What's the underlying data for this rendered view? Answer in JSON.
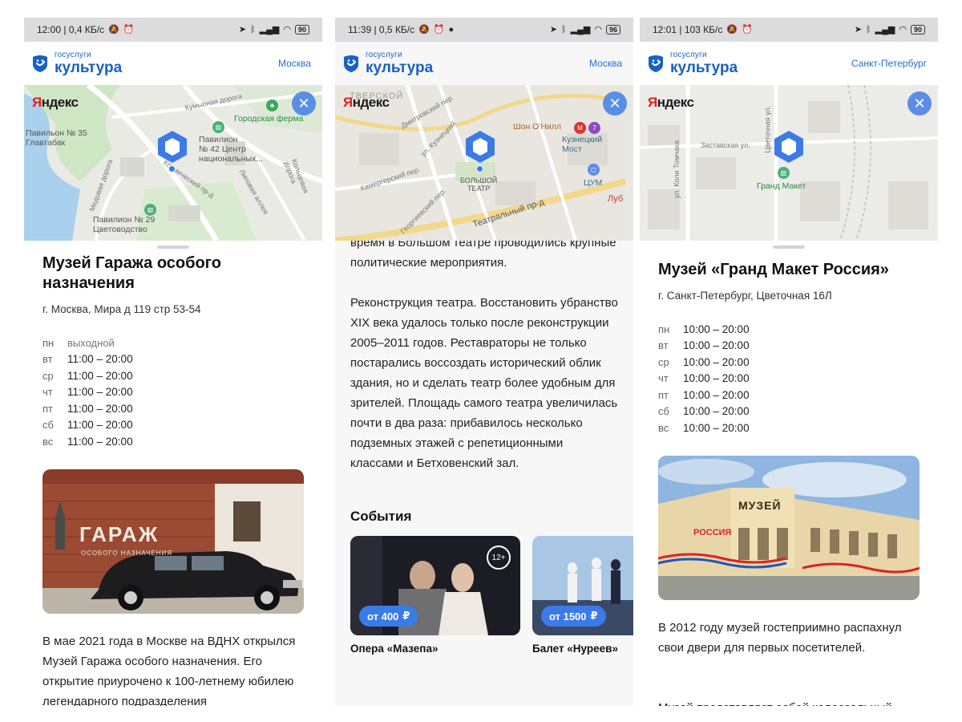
{
  "app": {
    "logo_small": "госуслуги",
    "logo_big": "культура",
    "map_brand_prefix": "Я",
    "map_brand_rest": "ндекс"
  },
  "colors": {
    "accent": "#3b7be8",
    "brand": "#1760c7",
    "statusbar": "#dcdcde"
  },
  "screens": [
    {
      "status": {
        "time": "12:00 | 0,4 КБ/с",
        "battery": "90"
      },
      "city": "Москва",
      "map_labels": {
        "pavilion35": "Павильон № 35\nГлавтабак",
        "pavilion42": "Павилион\n№ 42 Центр\nнациональных...",
        "farm": "Городская ферма",
        "pavilion29": "Павилион № 29\nЦветоводство",
        "kumys": "Кумысная дорога",
        "medova": "Медовая дорога",
        "kosmich": "Космический пр-д",
        "lipov": "Липовая аллея",
        "kolcev": "Кольцевая дорога"
      },
      "title": "Музей Гаража особого назначения",
      "address": "г. Москва, Мира д 119 стр 53-54",
      "hours": [
        {
          "day": "пн",
          "time": "выходной"
        },
        {
          "day": "вт",
          "time": "11:00 – 20:00"
        },
        {
          "day": "ср",
          "time": "11:00 – 20:00"
        },
        {
          "day": "чт",
          "time": "11:00 – 20:00"
        },
        {
          "day": "пт",
          "time": "11:00 – 20:00"
        },
        {
          "day": "сб",
          "time": "11:00 – 20:00"
        },
        {
          "day": "вс",
          "time": "11:00 – 20:00"
        }
      ],
      "photo_text_main": "ГАРАЖ",
      "photo_text_sub": "ОСОБОГО НАЗНАЧЕНИЯ",
      "description": "В мае 2021 года в Москве на ВДНХ открылся Музей Гаража особого назначения. Его открытие приурочено к 100-летнему юбилею легендарного подразделения"
    },
    {
      "status": {
        "time": "11:39 | 0,5 КБ/с",
        "battery": "96"
      },
      "city": "Москва",
      "map_labels": {
        "tverskaya": "ТВЕРСКОЙ",
        "shon": "Шон О'Нилл",
        "kuznetsky": "Кузнецкий\nМост",
        "tsum": "ЦУМ",
        "bolshoi": "БОЛЬШОЙ\nТЕАТР",
        "teatralny": "Театральный пр-д",
        "dmitrovsky": "Дмитровский пер.",
        "kuznetsky_st": "ул. Кузнецкий",
        "kamergersky": "Камергерский пер.",
        "georgievsky": "Георгиевский пер.",
        "lub": "Луб"
      },
      "text_top": "время в Большом театре проводились крупные политические мероприятия.",
      "text_main": "Реконструкция театра. Восстановить убранство XIX века удалось только после реконструкции 2005–2011 годов. Реставраторы не только постарались воссоздать исторический облик здания, но и сделать театр более удобным для зрителей. Площадь самого театра увеличилась почти в два раза: прибавилось несколько подземных этажей с репетиционными классами и Бетховенский зал.",
      "events_title": "События",
      "events": [
        {
          "name": "Опера «Мазепа»",
          "price": "от 400",
          "age": "12+"
        },
        {
          "name": "Балет «Нуреев»",
          "price": "от 1500"
        }
      ],
      "currency": "₽"
    },
    {
      "status": {
        "time": "12:01 | 103 КБ/с",
        "battery": "90"
      },
      "city": "Санкт-Петербург",
      "map_labels": {
        "zastavskaya": "Заставская ул.",
        "grand": "Гранд Макет",
        "kolya": "ул. Коли Томчака",
        "tsvetoch": "Цветочная ул."
      },
      "title": "Музей «Гранд Макет Россия»",
      "address": "г. Санкт-Петербург, Цветочная 16Л",
      "hours": [
        {
          "day": "пн",
          "time": "10:00 – 20:00"
        },
        {
          "day": "вт",
          "time": "10:00 – 20:00"
        },
        {
          "day": "ср",
          "time": "10:00 – 20:00"
        },
        {
          "day": "чт",
          "time": "10:00 – 20:00"
        },
        {
          "day": "пт",
          "time": "10:00 – 20:00"
        },
        {
          "day": "сб",
          "time": "10:00 – 20:00"
        },
        {
          "day": "вс",
          "time": "10:00 – 20:00"
        }
      ],
      "photo_sign": "МУЗЕЙ",
      "photo_brand": "РОССИЯ",
      "description": "В 2012 году музей гостеприимно распахнул свои двери для первых посетителей.",
      "description2": "Музей представляет собой колоссальный"
    }
  ]
}
